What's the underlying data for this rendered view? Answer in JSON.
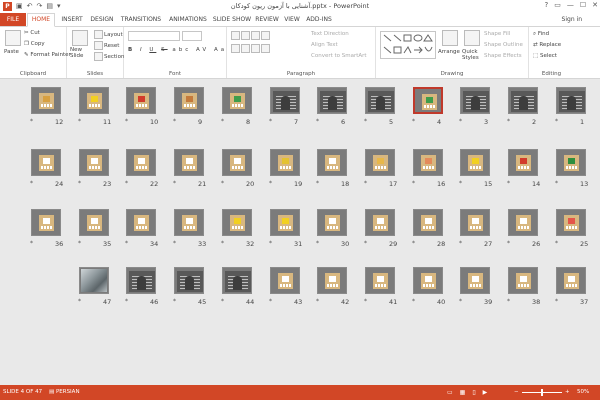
{
  "app": {
    "title": "آشنایی با آزمون ریون کودکان.pptx - PowerPoint",
    "logo": "P",
    "signin": "Sign in",
    "quick_access": [
      "save-icon",
      "undo-icon",
      "redo-icon",
      "start-from-beginning-icon",
      "customize-icon"
    ],
    "window_controls": [
      "?",
      "▭",
      "—",
      "☐",
      "✕"
    ]
  },
  "tabs": [
    "FILE",
    "HOME",
    "INSERT",
    "DESIGN",
    "TRANSITIONS",
    "ANIMATIONS",
    "SLIDE SHOW",
    "REVIEW",
    "VIEW",
    "ADD-INS"
  ],
  "active_tab": "HOME",
  "ribbon": {
    "clipboard": {
      "label": "Clipboard",
      "paste": "Paste",
      "cut": "Cut",
      "copy": "Copy",
      "format_painter": "Format Painter"
    },
    "slides": {
      "label": "Slides",
      "new_slide": "New Slide",
      "layout": "Layout",
      "reset": "Reset",
      "section": "Section"
    },
    "font": {
      "label": "Font",
      "buttons": [
        "B",
        "I",
        "U",
        "S",
        "abc",
        "AV",
        "Aa",
        "A"
      ]
    },
    "paragraph": {
      "label": "Paragraph",
      "text_direction": "Text Direction",
      "align_text": "Align Text",
      "convert_smartart": "Convert to SmartArt"
    },
    "drawing": {
      "label": "Drawing",
      "arrange": "Arrange",
      "quick_styles": "Quick Styles",
      "shape_fill": "Shape Fill",
      "shape_outline": "Shape Outline",
      "shape_effects": "Shape Effects"
    },
    "editing": {
      "label": "Editing",
      "find": "Find",
      "replace": "Replace",
      "select": "Select"
    }
  },
  "slides": [
    {
      "n": "12",
      "kind": "card",
      "chip": "#d8a040"
    },
    {
      "n": "11",
      "kind": "card",
      "chip": "#f2d021"
    },
    {
      "n": "10",
      "kind": "card",
      "chip": "#d23b2b"
    },
    {
      "n": "9",
      "kind": "card",
      "chip": "#c47a3b"
    },
    {
      "n": "8",
      "kind": "card",
      "chip": "#3f9d4b"
    },
    {
      "n": "7",
      "kind": "dark"
    },
    {
      "n": "6",
      "kind": "dark"
    },
    {
      "n": "5",
      "kind": "dark"
    },
    {
      "n": "4",
      "kind": "card",
      "chip": "#3f9d4b",
      "selected": true
    },
    {
      "n": "3",
      "kind": "dark"
    },
    {
      "n": "2",
      "kind": "dark"
    },
    {
      "n": "1",
      "kind": "dark"
    },
    {
      "n": "24",
      "kind": "card",
      "chip": "#ffffff"
    },
    {
      "n": "23",
      "kind": "card",
      "chip": "#ffffff"
    },
    {
      "n": "22",
      "kind": "card",
      "chip": "#ffffff"
    },
    {
      "n": "21",
      "kind": "card",
      "chip": "#ffffff"
    },
    {
      "n": "20",
      "kind": "card",
      "chip": "#ffffff"
    },
    {
      "n": "19",
      "kind": "card",
      "chip": "#e4c232"
    },
    {
      "n": "18",
      "kind": "card",
      "chip": "#ffffff"
    },
    {
      "n": "17",
      "kind": "card",
      "chip": "#e8b84a"
    },
    {
      "n": "16",
      "kind": "card",
      "chip": "#e48a5a"
    },
    {
      "n": "15",
      "kind": "card",
      "chip": "#f2d021"
    },
    {
      "n": "14",
      "kind": "card",
      "chip": "#d23b2b"
    },
    {
      "n": "13",
      "kind": "card",
      "chip": "#2f8f3e"
    },
    {
      "n": "36",
      "kind": "card",
      "chip": "#ffffff"
    },
    {
      "n": "35",
      "kind": "card",
      "chip": "#ffffff"
    },
    {
      "n": "34",
      "kind": "card",
      "chip": "#ffffff"
    },
    {
      "n": "33",
      "kind": "card",
      "chip": "#ffffff"
    },
    {
      "n": "32",
      "kind": "card",
      "chip": "#f2d021"
    },
    {
      "n": "31",
      "kind": "card",
      "chip": "#f2d021"
    },
    {
      "n": "30",
      "kind": "card",
      "chip": "#ffffff"
    },
    {
      "n": "29",
      "kind": "card",
      "chip": "#ffffff"
    },
    {
      "n": "28",
      "kind": "card",
      "chip": "#ffffff"
    },
    {
      "n": "27",
      "kind": "card",
      "chip": "#ffffff"
    },
    {
      "n": "26",
      "kind": "card",
      "chip": "#ffffff"
    },
    {
      "n": "25",
      "kind": "card",
      "chip": "#e4554a"
    },
    {
      "n": "47",
      "kind": "photo"
    },
    {
      "n": "46",
      "kind": "dark"
    },
    {
      "n": "45",
      "kind": "dark"
    },
    {
      "n": "44",
      "kind": "dark"
    },
    {
      "n": "43",
      "kind": "card",
      "chip": "#ffffff"
    },
    {
      "n": "42",
      "kind": "card",
      "chip": "#ffffff"
    },
    {
      "n": "41",
      "kind": "card",
      "chip": "#ffffff"
    },
    {
      "n": "40",
      "kind": "card",
      "chip": "#ffffff"
    },
    {
      "n": "39",
      "kind": "card",
      "chip": "#ffffff"
    },
    {
      "n": "38",
      "kind": "card",
      "chip": "#ffffff"
    },
    {
      "n": "37",
      "kind": "card",
      "chip": "#ffffff"
    }
  ],
  "status": {
    "slide_info": "SLIDE 4 OF 47",
    "language": "PERSIAN",
    "zoom": "50%"
  },
  "colors": {
    "accent": "#d24726",
    "selected_border": "#c0392b"
  }
}
